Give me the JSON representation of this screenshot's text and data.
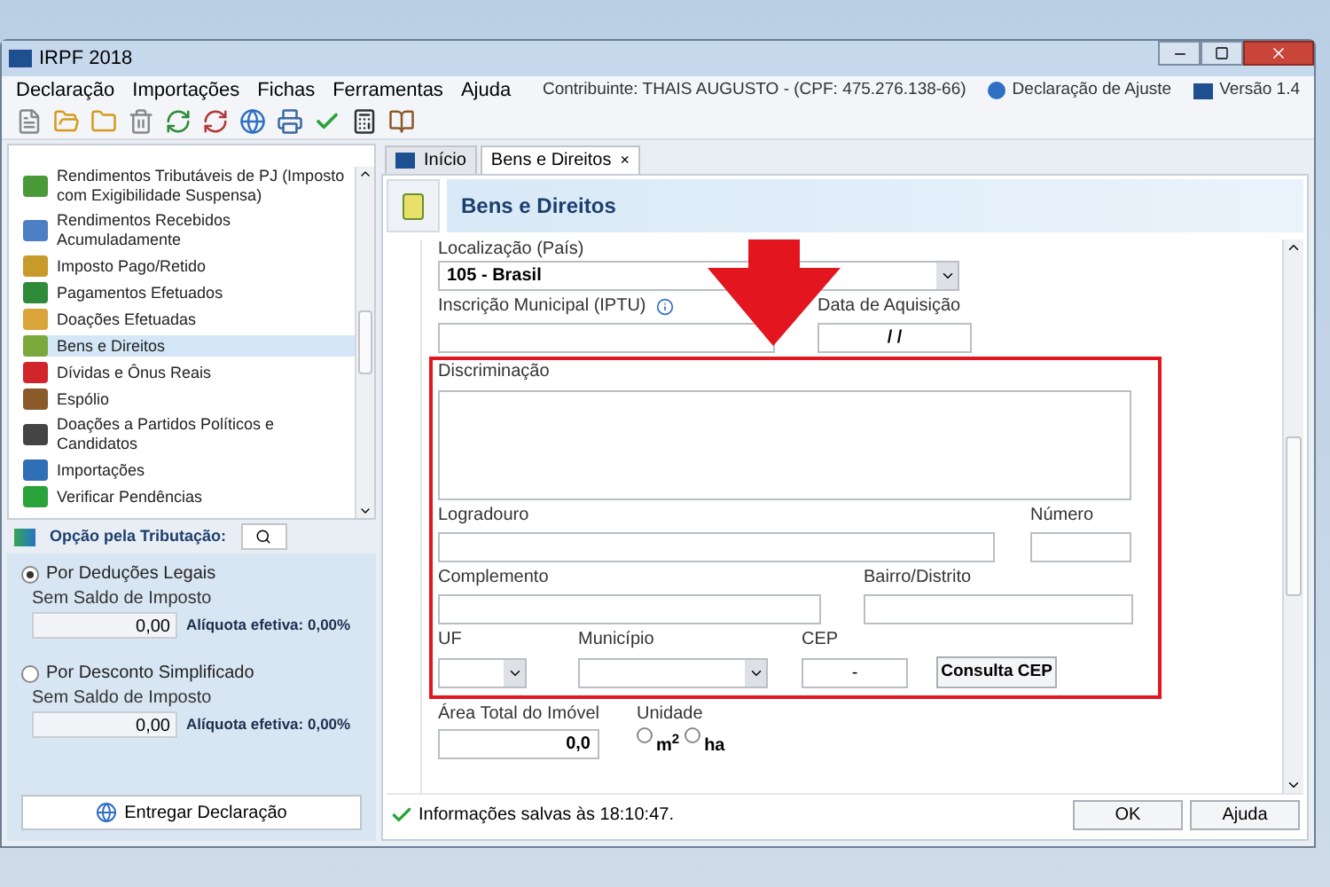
{
  "window": {
    "title": "IRPF 2018"
  },
  "menu": [
    "Declaração",
    "Importações",
    "Fichas",
    "Ferramentas",
    "Ajuda"
  ],
  "header_info": {
    "taxpayer": "Contribuinte: THAIS AUGUSTO - (CPF: 475.276.138-66)",
    "declaration": "Declaração de Ajuste",
    "version": "Versão 1.4"
  },
  "sidebar": {
    "items": [
      {
        "label": "Rendimentos Tributáveis de PJ (Imposto com Exigibilidade Suspensa)",
        "selected": false
      },
      {
        "label": "Rendimentos Recebidos Acumuladamente",
        "selected": false
      },
      {
        "label": "Imposto Pago/Retido",
        "selected": false
      },
      {
        "label": "Pagamentos Efetuados",
        "selected": false
      },
      {
        "label": "Doações Efetuadas",
        "selected": false
      },
      {
        "label": "Bens e Direitos",
        "selected": true
      },
      {
        "label": "Dívidas e Ônus Reais",
        "selected": false
      },
      {
        "label": "Espólio",
        "selected": false
      },
      {
        "label": "Doações a Partidos Políticos e Candidatos",
        "selected": false
      },
      {
        "label": "Importações",
        "selected": false
      },
      {
        "label": "Verificar Pendências",
        "selected": false
      }
    ]
  },
  "taxation": {
    "title": "Opção pela Tributação:",
    "options": [
      {
        "label": "Por Deduções Legais",
        "selected": true,
        "sublabel": "Sem Saldo de Imposto",
        "value": "0,00",
        "rate": "Alíquota efetiva: 0,00%"
      },
      {
        "label": "Por Desconto Simplificado",
        "selected": false,
        "sublabel": "Sem Saldo de Imposto",
        "value": "0,00",
        "rate": "Alíquota efetiva: 0,00%"
      }
    ],
    "submit": "Entregar Declaração"
  },
  "tabs": [
    {
      "label": "Início",
      "selected": false,
      "closable": false
    },
    {
      "label": "Bens e Direitos",
      "selected": true,
      "closable": true
    }
  ],
  "close_glyph": "×",
  "panel_title": "Bens e Direitos",
  "form": {
    "country_label": "Localização (País)",
    "country_value": "105 - Brasil",
    "iptu_label": "Inscrição Municipal (IPTU)",
    "date_label": "Data de Aquisição",
    "date_value": "/ /",
    "description_label": "Discriminação",
    "street_label": "Logradouro",
    "number_label": "Número",
    "complement_label": "Complemento",
    "district_label": "Bairro/Distrito",
    "state_label": "UF",
    "city_label": "Município",
    "cep_label": "CEP",
    "cep_value": "-",
    "cep_button": "Consulta CEP",
    "area_label": "Área Total do Imóvel",
    "area_value": "0,0",
    "unit_label": "Unidade",
    "units": [
      {
        "label": "m$^{2}$",
        "selected": false
      },
      {
        "label": "ha",
        "selected": false
      }
    ]
  },
  "status_bar": {
    "message": "Informações salvas às 18:10:47.",
    "buttons": [
      "OK",
      "Ajuda"
    ]
  }
}
